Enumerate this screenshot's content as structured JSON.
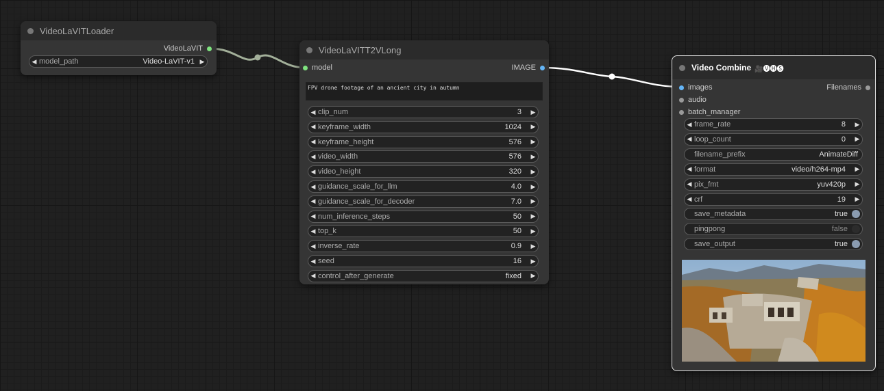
{
  "colors": {
    "canvas": "#202020",
    "node_body": "#353535",
    "node_title": "#2b2b2b",
    "widget_bg": "#222222",
    "model_socket": "#7fe37f",
    "image_socket": "#64b5f6",
    "toggle_on": "#8a9bb0"
  },
  "loader": {
    "title": "VideoLaVITLoader",
    "output_label": "VideoLaVIT",
    "model_path": {
      "name": "model_path",
      "value": "Video-LaVIT-v1"
    }
  },
  "t2v": {
    "title": "VideoLaVITT2VLong",
    "input_label": "model",
    "output_label": "IMAGE",
    "prompt": "FPV drone footage of an ancient city in autumn",
    "widgets": [
      {
        "name": "clip_num",
        "value": "3"
      },
      {
        "name": "keyframe_width",
        "value": "1024"
      },
      {
        "name": "keyframe_height",
        "value": "576"
      },
      {
        "name": "video_width",
        "value": "576"
      },
      {
        "name": "video_height",
        "value": "320"
      },
      {
        "name": "guidance_scale_for_llm",
        "value": "4.0"
      },
      {
        "name": "guidance_scale_for_decoder",
        "value": "7.0"
      },
      {
        "name": "num_inference_steps",
        "value": "50"
      },
      {
        "name": "top_k",
        "value": "50"
      },
      {
        "name": "inverse_rate",
        "value": "0.9"
      },
      {
        "name": "seed",
        "value": "16"
      },
      {
        "name": "control_after_generate",
        "value": "fixed"
      }
    ]
  },
  "combine": {
    "title": "Video Combine",
    "title_icons": "🎥🅥🅗🅢",
    "inputs": [
      "images",
      "audio",
      "batch_manager"
    ],
    "output_label": "Filenames",
    "widgets": [
      {
        "name": "frame_rate",
        "value": "8"
      },
      {
        "name": "loop_count",
        "value": "0"
      },
      {
        "name": "filename_prefix",
        "value": "AnimateDiff"
      },
      {
        "name": "format",
        "value": "video/h264-mp4"
      },
      {
        "name": "pix_fmt",
        "value": "yuv420p"
      },
      {
        "name": "crf",
        "value": "19"
      },
      {
        "name": "save_metadata",
        "value": "true"
      },
      {
        "name": "pingpong",
        "value": "false"
      },
      {
        "name": "save_output",
        "value": "true"
      }
    ]
  }
}
